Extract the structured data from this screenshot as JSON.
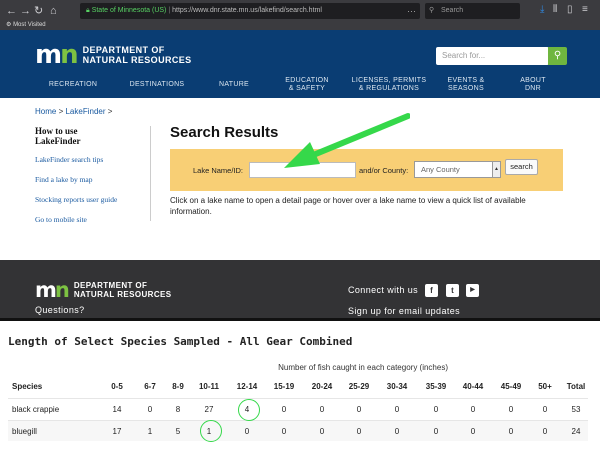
{
  "browser": {
    "nav_back": "←",
    "nav_forward": "→",
    "nav_reload": "↻",
    "nav_home": "⌂",
    "site_identity": "State of Minnesota (US)",
    "url": "https://www.dnr.state.mn.us/lakefind/search.html",
    "url_dots": "···",
    "search_placeholder": "Search",
    "bookmark_label": "Most Visited",
    "toolbar_icons": [
      "download-icon",
      "library-icon",
      "sidebar-icon",
      "menu-icon"
    ]
  },
  "header": {
    "logo_mark": "mn",
    "logo_line1": "DEPARTMENT OF",
    "logo_line2": "NATURAL RESOURCES",
    "search_placeholder": "Search for...",
    "nav": [
      {
        "line1": "RECREATION",
        "line2": ""
      },
      {
        "line1": "DESTINATIONS",
        "line2": ""
      },
      {
        "line1": "NATURE",
        "line2": ""
      },
      {
        "line1": "EDUCATION",
        "line2": "& SAFETY"
      },
      {
        "line1": "LICENSES, PERMITS",
        "line2": "& REGULATIONS"
      },
      {
        "line1": "EVENTS &",
        "line2": "SEASONS"
      },
      {
        "line1": "ABOUT",
        "line2": "DNR"
      }
    ]
  },
  "breadcrumb": {
    "home": "Home",
    "sep1": ">",
    "lakefinder": "LakeFinder",
    "sep2": ">"
  },
  "sidebar": {
    "heading_line1": "How to use",
    "heading_line2": "LakeFinder",
    "links": [
      "LakeFinder search tips",
      "Find a lake by map",
      "Stocking reports user guide",
      "Go to mobile site"
    ]
  },
  "search": {
    "title": "Search Results",
    "lake_label": "Lake Name/ID:",
    "lake_value": "",
    "county_label": "and/or County:",
    "county_value": "Any County",
    "button": "search",
    "instructions": "Click on a lake name to open a detail page or hover over a lake name to view a quick list of available information."
  },
  "footer": {
    "logo_line1": "DEPARTMENT OF",
    "logo_line2": "NATURAL RESOURCES",
    "questions": "Questions?",
    "connect": "Connect with us",
    "social": [
      {
        "icon": "facebook-icon",
        "glyph": "f"
      },
      {
        "icon": "twitter-icon",
        "glyph": "t"
      },
      {
        "icon": "youtube-icon",
        "glyph": "▶"
      }
    ],
    "signup": "Sign up for email updates"
  },
  "species_table": {
    "title": "Length of Select Species Sampled - All Gear Combined",
    "subtitle": "Number of fish caught in each category (inches)",
    "columns": [
      "Species",
      "0-5",
      "6-7",
      "8-9",
      "10-11",
      "12-14",
      "15-19",
      "20-24",
      "25-29",
      "30-34",
      "35-39",
      "40-44",
      "45-49",
      "50+",
      "Total"
    ],
    "rows": [
      {
        "species": "black crappie",
        "values": [
          "14",
          "0",
          "8",
          "27",
          "4",
          "0",
          "0",
          "0",
          "0",
          "0",
          "0",
          "0",
          "0",
          "53"
        ]
      },
      {
        "species": "bluegill",
        "values": [
          "17",
          "1",
          "5",
          "1",
          "0",
          "0",
          "0",
          "0",
          "0",
          "0",
          "0",
          "0",
          "0",
          "24"
        ]
      }
    ],
    "highlight_color": "#35d84a"
  },
  "colors": {
    "header_blue": "#0a3d73",
    "search_panel": "#f8cf75",
    "footer": "#333335",
    "accent_green": "#6fb63f",
    "annotation_green": "#35d84a"
  }
}
